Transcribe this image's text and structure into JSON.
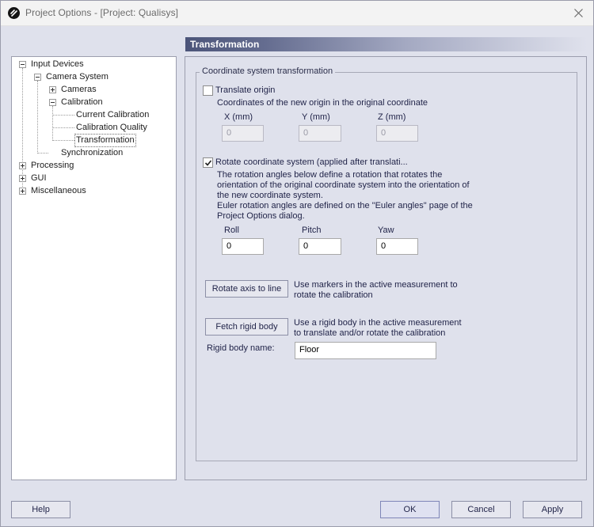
{
  "window": {
    "title": "Project Options - [Project: Qualisys]"
  },
  "tree": {
    "items": [
      {
        "label": "Input Devices",
        "expander": "minus"
      },
      {
        "label": "Camera System",
        "expander": "minus"
      },
      {
        "label": "Cameras",
        "expander": "plus"
      },
      {
        "label": "Calibration",
        "expander": "minus"
      },
      {
        "label": "Current Calibration"
      },
      {
        "label": "Calibration Quality"
      },
      {
        "label": "Transformation",
        "selected": true
      },
      {
        "label": "Synchronization"
      },
      {
        "label": "Processing",
        "expander": "plus"
      },
      {
        "label": "GUI",
        "expander": "plus"
      },
      {
        "label": "Miscellaneous",
        "expander": "plus"
      }
    ]
  },
  "panel": {
    "header": "Transformation",
    "group_title": "Coordinate system transformation",
    "translate": {
      "label": "Translate origin",
      "checked": false,
      "desc": "Coordinates of the new origin in the original coordinate",
      "fields": [
        {
          "label": "X (mm)",
          "value": "0"
        },
        {
          "label": "Y (mm)",
          "value": "0"
        },
        {
          "label": "Z (mm)",
          "value": "0"
        }
      ]
    },
    "rotate": {
      "label": "Rotate coordinate system (applied after translati...",
      "checked": true,
      "desc_lines": [
        "The rotation angles below define a rotation that rotates the",
        "orientation of the original coordinate system into the orientation of",
        "the new coordinate system.",
        "Euler rotation angles are defined on the \"Euler angles\" page of the",
        "Project Options dialog."
      ],
      "fields": [
        {
          "label": "Roll",
          "value": "0"
        },
        {
          "label": "Pitch",
          "value": "0"
        },
        {
          "label": "Yaw",
          "value": "0"
        }
      ]
    },
    "rotate_axis": {
      "button": "Rotate axis to line",
      "desc_lines": [
        "Use markers in the active measurement to",
        "rotate the calibration"
      ]
    },
    "rigid_body": {
      "button": "Fetch rigid body",
      "desc_lines": [
        "Use a rigid body in the active measurement",
        "to translate and/or rotate the calibration"
      ],
      "name_label": "Rigid body name:",
      "name_value": "Floor"
    }
  },
  "footer": {
    "help": "Help",
    "ok": "OK",
    "cancel": "Cancel",
    "apply": "Apply"
  }
}
